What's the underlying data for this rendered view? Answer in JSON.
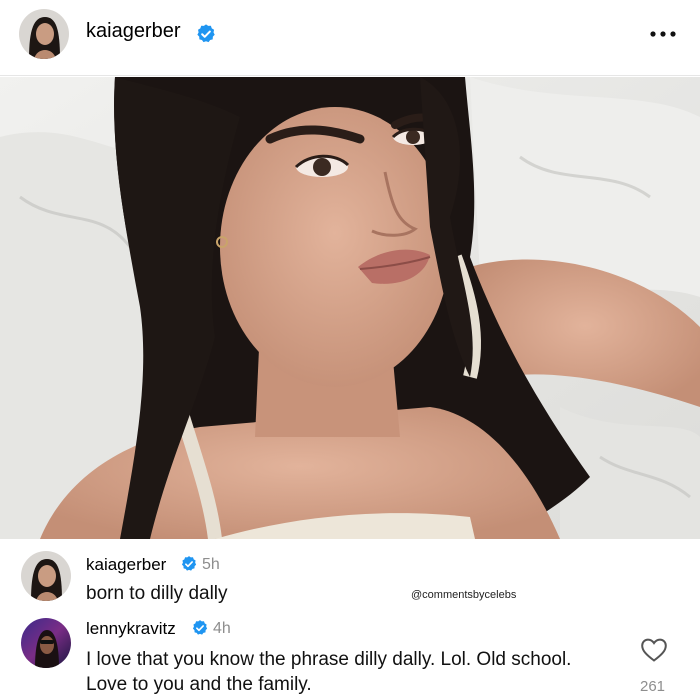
{
  "post": {
    "username": "kaiagerber",
    "verified_icon": "verified-badge-icon",
    "more_icon": "more-horizontal-icon"
  },
  "comments": [
    {
      "username": "kaiagerber",
      "time": "5h",
      "text": "born to dilly dally",
      "watermark": "@commentsbycelebs"
    },
    {
      "username": "lennykravitz",
      "time": "4h",
      "text": "I love that you know the phrase dilly dally. Lol. Old school. Love to you and the family.",
      "likes": "261",
      "like_icon": "heart-outline-icon"
    }
  ],
  "colors": {
    "verified": "#1f95f1",
    "muted": "#8e8e8e"
  }
}
